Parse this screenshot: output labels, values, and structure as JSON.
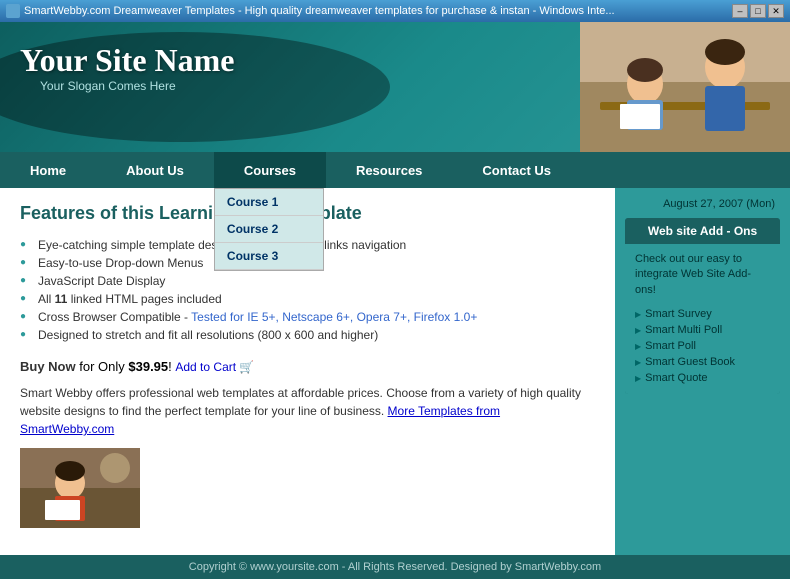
{
  "titlebar": {
    "title": "SmartWebby.com Dreamweaver Templates - High quality dreamweaver templates for purchase & instan - Windows Inte...",
    "min": "–",
    "max": "□",
    "close": "✕"
  },
  "header": {
    "site_name": "Your Site Name",
    "slogan": "Your Slogan Comes Here"
  },
  "nav": {
    "items": [
      {
        "label": "Home",
        "id": "home"
      },
      {
        "label": "About Us",
        "id": "about"
      },
      {
        "label": "Courses",
        "id": "courses",
        "active": true
      },
      {
        "label": "Resources",
        "id": "resources"
      },
      {
        "label": "Contact Us",
        "id": "contact"
      }
    ],
    "dropdown": {
      "items": [
        "Course 1",
        "Course 2",
        "Course 3"
      ]
    }
  },
  "main": {
    "date": "August 27, 2007 (Mon)",
    "page_title": "Features of this Learning/Kids Template",
    "features": [
      "Eye-catching simple template designed with neat text links navigation",
      "Easy-to-use Drop-down Menus",
      "JavaScript Date Display",
      "All 11 linked HTML pages included",
      "Cross Browser Compatible - Tested for IE 5+, Netscape 6+, Opera 7+, Firefox 1.0+",
      "Designed to stretch and fit all resolutions (800 x 600 and higher)"
    ],
    "feature_bold": "11",
    "tested_text": "Tested for IE 5+, Netscape 6+, Opera 7+, Firefox 1.0+",
    "buy_label": "Buy Now",
    "buy_suffix": " for Only ",
    "price": "$39.95",
    "add_cart": "Add to Cart 🛒",
    "description": "Smart Webby offers professional web templates at affordable prices. Choose from a variety of high quality website designs to find the perfect template for your line of business.",
    "more_link": "More Templates from SmartWebby.com"
  },
  "sidebar": {
    "date": "August 27, 2007 (Mon)",
    "box_title": "Web site Add - Ons",
    "intro": "Check out our easy to integrate Web Site Add-ons!",
    "links": [
      "Smart Survey",
      "Smart Multi Poll",
      "Smart Poll",
      "Smart Guest Book",
      "Smart Quote"
    ]
  },
  "footer": {
    "text": "Copyright © www.yoursite.com - All Rights Reserved. Designed by SmartWebby.com"
  }
}
